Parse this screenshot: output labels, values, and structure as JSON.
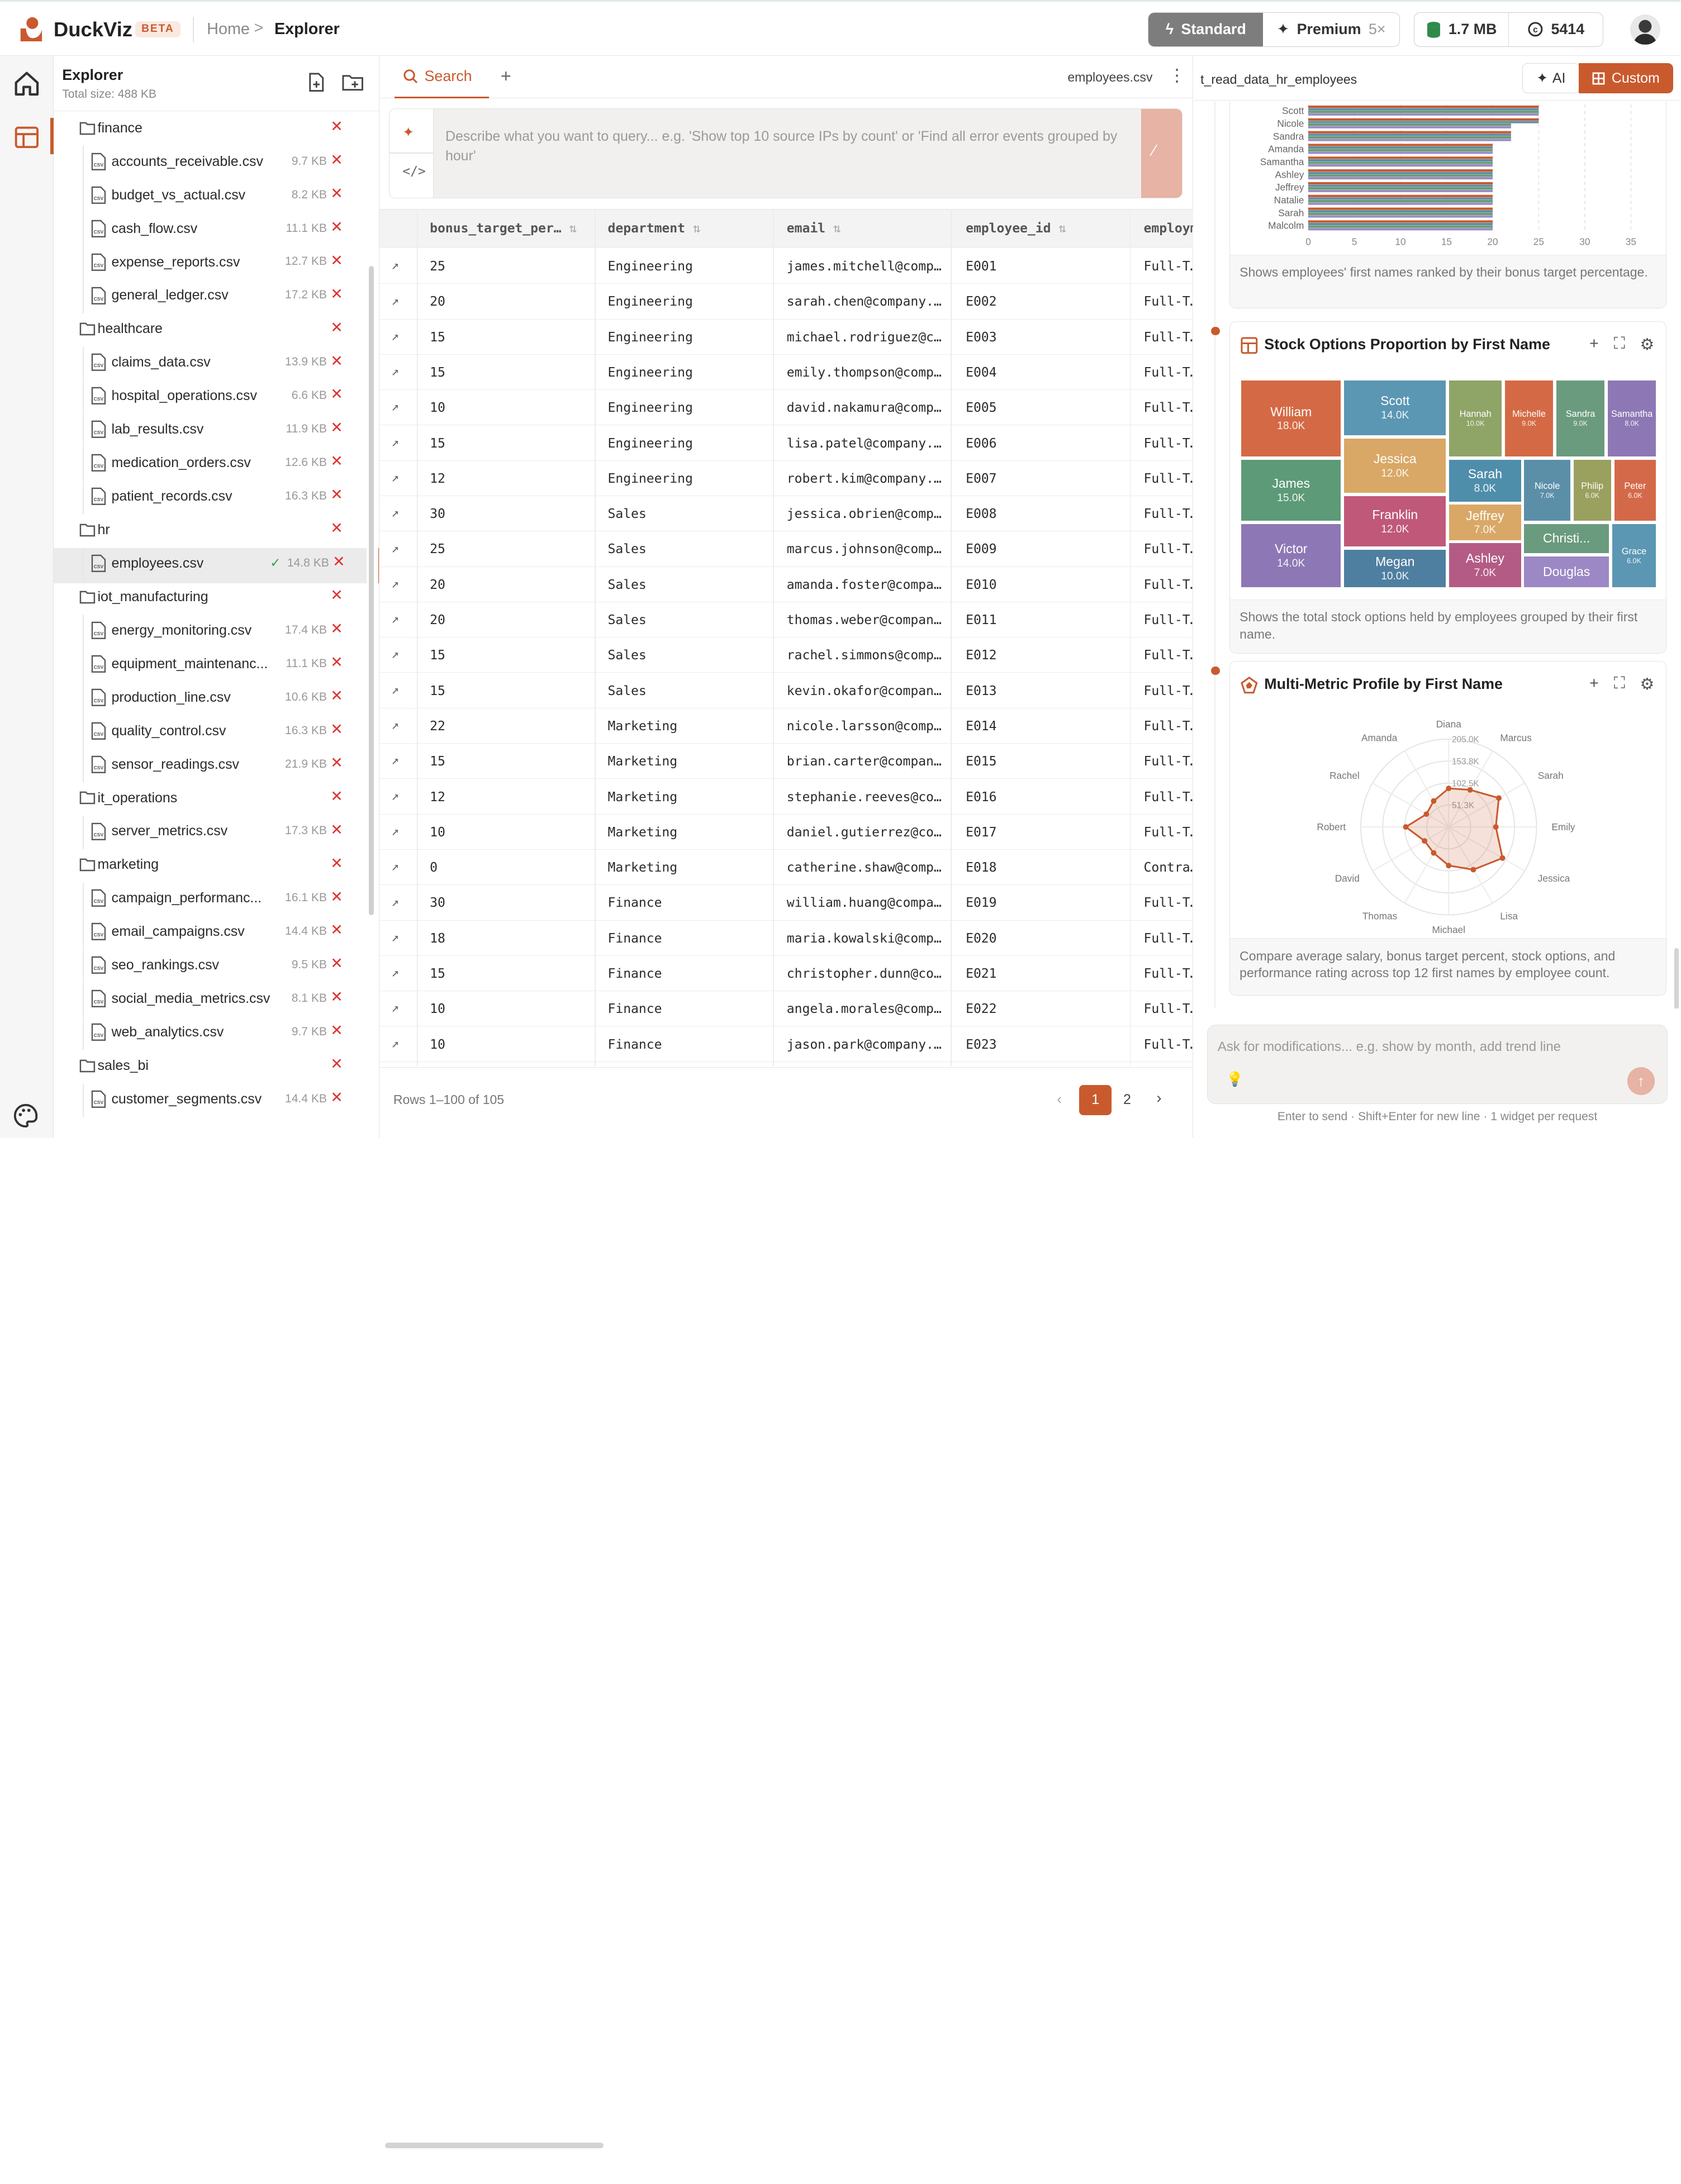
{
  "app": {
    "name": "DuckViz",
    "badge": "BETA"
  },
  "breadcrumb": {
    "home": "Home",
    "separator": ">",
    "current": "Explorer"
  },
  "tier": {
    "standard": "Standard",
    "premium": "Premium",
    "premium_mult": "5×"
  },
  "stats": {
    "storage": "1.7 MB",
    "credits": "5414"
  },
  "explorer": {
    "title": "Explorer",
    "total": "Total size: 488 KB",
    "tree": [
      {
        "type": "folder",
        "name": "finance"
      },
      {
        "type": "file",
        "name": "accounts_receivable.csv",
        "size": "9.7 KB"
      },
      {
        "type": "file",
        "name": "budget_vs_actual.csv",
        "size": "8.2 KB"
      },
      {
        "type": "file",
        "name": "cash_flow.csv",
        "size": "11.1 KB"
      },
      {
        "type": "file",
        "name": "expense_reports.csv",
        "size": "12.7 KB"
      },
      {
        "type": "file",
        "name": "general_ledger.csv",
        "size": "17.2 KB"
      },
      {
        "type": "folder",
        "name": "healthcare"
      },
      {
        "type": "file",
        "name": "claims_data.csv",
        "size": "13.9 KB"
      },
      {
        "type": "file",
        "name": "hospital_operations.csv",
        "size": "6.6 KB"
      },
      {
        "type": "file",
        "name": "lab_results.csv",
        "size": "11.9 KB"
      },
      {
        "type": "file",
        "name": "medication_orders.csv",
        "size": "12.6 KB"
      },
      {
        "type": "file",
        "name": "patient_records.csv",
        "size": "16.3 KB"
      },
      {
        "type": "folder",
        "name": "hr"
      },
      {
        "type": "file",
        "name": "employees.csv",
        "size": "14.8 KB",
        "selected": true
      },
      {
        "type": "folder",
        "name": "iot_manufacturing"
      },
      {
        "type": "file",
        "name": "energy_monitoring.csv",
        "size": "17.4 KB"
      },
      {
        "type": "file",
        "name": "equipment_maintenanc...",
        "size": "11.1 KB"
      },
      {
        "type": "file",
        "name": "production_line.csv",
        "size": "10.6 KB"
      },
      {
        "type": "file",
        "name": "quality_control.csv",
        "size": "16.3 KB"
      },
      {
        "type": "file",
        "name": "sensor_readings.csv",
        "size": "21.9 KB"
      },
      {
        "type": "folder",
        "name": "it_operations"
      },
      {
        "type": "file",
        "name": "server_metrics.csv",
        "size": "17.3 KB"
      },
      {
        "type": "folder",
        "name": "marketing"
      },
      {
        "type": "file",
        "name": "campaign_performanc...",
        "size": "16.1 KB"
      },
      {
        "type": "file",
        "name": "email_campaigns.csv",
        "size": "14.4 KB"
      },
      {
        "type": "file",
        "name": "seo_rankings.csv",
        "size": "9.5 KB"
      },
      {
        "type": "file",
        "name": "social_media_metrics.csv",
        "size": "8.1 KB"
      },
      {
        "type": "file",
        "name": "web_analytics.csv",
        "size": "9.7 KB"
      },
      {
        "type": "folder",
        "name": "sales_bi"
      },
      {
        "type": "file",
        "name": "customer_segments.csv",
        "size": "14.4 KB"
      }
    ]
  },
  "center": {
    "tab": "Search",
    "file": "employees.csv",
    "query_placeholder": "Describe what you want to query... e.g. 'Show top 10 source IPs by count' or 'Find all error events grouped by hour'",
    "columns": [
      "bonus_target_per…",
      "department",
      "email",
      "employee_id",
      "employm…"
    ],
    "rows": [
      [
        "25",
        "Engineering",
        "james.mitchell@comp…",
        "E001",
        "Full-T…"
      ],
      [
        "20",
        "Engineering",
        "sarah.chen@company.…",
        "E002",
        "Full-T…"
      ],
      [
        "15",
        "Engineering",
        "michael.rodriguez@c…",
        "E003",
        "Full-T…"
      ],
      [
        "15",
        "Engineering",
        "emily.thompson@comp…",
        "E004",
        "Full-T…"
      ],
      [
        "10",
        "Engineering",
        "david.nakamura@comp…",
        "E005",
        "Full-T…"
      ],
      [
        "15",
        "Engineering",
        "lisa.patel@company.…",
        "E006",
        "Full-T…"
      ],
      [
        "12",
        "Engineering",
        "robert.kim@company.…",
        "E007",
        "Full-T…"
      ],
      [
        "30",
        "Sales",
        "jessica.obrien@comp…",
        "E008",
        "Full-T…"
      ],
      [
        "25",
        "Sales",
        "marcus.johnson@comp…",
        "E009",
        "Full-T…"
      ],
      [
        "20",
        "Sales",
        "amanda.foster@compa…",
        "E010",
        "Full-T…"
      ],
      [
        "20",
        "Sales",
        "thomas.weber@compan…",
        "E011",
        "Full-T…"
      ],
      [
        "15",
        "Sales",
        "rachel.simmons@comp…",
        "E012",
        "Full-T…"
      ],
      [
        "15",
        "Sales",
        "kevin.okafor@compan…",
        "E013",
        "Full-T…"
      ],
      [
        "22",
        "Marketing",
        "nicole.larsson@comp…",
        "E014",
        "Full-T…"
      ],
      [
        "15",
        "Marketing",
        "brian.carter@compan…",
        "E015",
        "Full-T…"
      ],
      [
        "12",
        "Marketing",
        "stephanie.reeves@co…",
        "E016",
        "Full-T…"
      ],
      [
        "10",
        "Marketing",
        "daniel.gutierrez@co…",
        "E017",
        "Full-T…"
      ],
      [
        "0",
        "Marketing",
        "catherine.shaw@comp…",
        "E018",
        "Contra…"
      ],
      [
        "30",
        "Finance",
        "william.huang@compa…",
        "E019",
        "Full-T…"
      ],
      [
        "18",
        "Finance",
        "maria.kowalski@comp…",
        "E020",
        "Full-T…"
      ],
      [
        "15",
        "Finance",
        "christopher.dunn@co…",
        "E021",
        "Full-T…"
      ],
      [
        "10",
        "Finance",
        "angela.morales@comp…",
        "E022",
        "Full-T…"
      ],
      [
        "10",
        "Finance",
        "jason.park@company.…",
        "E023",
        "Full-T…"
      ]
    ],
    "pager": {
      "info": "Rows 1–100 of 105",
      "page1": "1",
      "page2": "2"
    }
  },
  "right": {
    "title": "t_read_data_hr_employees",
    "ai": "AI",
    "custom": "Custom",
    "cards": {
      "bar_desc": "Shows employees' first names ranked by their bonus target percentage.",
      "treemap_title": "Stock Options Proportion by First Name",
      "treemap_desc": "Shows the total stock options held by employees grouped by their first name.",
      "radar_title": "Multi-Metric Profile by First Name",
      "radar_desc": "Compare average salary, bonus target percent, stock options, and performance rating across top 12 first names by employee count."
    },
    "chat_placeholder": "Ask for modifications... e.g. show by month, add trend line",
    "chat_hint": "Enter to send · Shift+Enter for new line · 1 widget per request"
  },
  "chart_data": [
    {
      "type": "bar",
      "orientation": "horizontal",
      "categories": [
        "Scott",
        "Nicole",
        "Sandra",
        "Amanda",
        "Samantha",
        "Ashley",
        "Jeffrey",
        "Natalie",
        "Sarah",
        "Malcolm"
      ],
      "series": [
        {
          "values": [
            25,
            25,
            22,
            20,
            20,
            20,
            20,
            20,
            20,
            20
          ]
        },
        {
          "values": [
            25,
            25,
            22,
            20,
            20,
            20,
            20,
            20,
            20,
            20
          ]
        },
        {
          "values": [
            25,
            22,
            22,
            20,
            20,
            20,
            20,
            20,
            20,
            20
          ]
        },
        {
          "values": [
            25,
            22,
            22,
            20,
            20,
            20,
            20,
            20,
            20,
            20
          ]
        }
      ],
      "xticks": [
        "0",
        "5",
        "10",
        "15",
        "20",
        "25",
        "30",
        "35"
      ],
      "xlim": [
        0,
        35
      ],
      "colors": [
        "#c95a2e",
        "#5b8fa8",
        "#6a9b72",
        "#9b8cc4"
      ]
    },
    {
      "type": "treemap",
      "items": [
        {
          "name": "William",
          "label": "18.0K",
          "value": 18000,
          "color": "#d46a45"
        },
        {
          "name": "Scott",
          "label": "14.0K",
          "value": 14000,
          "color": "#5b96b3"
        },
        {
          "name": "Hannah",
          "label": "10.0K",
          "value": 10000,
          "color": "#8fa467"
        },
        {
          "name": "Michelle",
          "label": "9.0K",
          "value": 9000,
          "color": "#d46a45"
        },
        {
          "name": "Sandra",
          "label": "9.0K",
          "value": 9000,
          "color": "#6a9b7e"
        },
        {
          "name": "Samantha",
          "label": "8.0K",
          "value": 8000,
          "color": "#8d78b5"
        },
        {
          "name": "James",
          "label": "15.0K",
          "value": 15000,
          "color": "#5c9a78"
        },
        {
          "name": "Jessica",
          "label": "12.0K",
          "value": 12000,
          "color": "#d9a866"
        },
        {
          "name": "Sarah",
          "label": "8.0K",
          "value": 8000,
          "color": "#4f8eab"
        },
        {
          "name": "Nicole",
          "label": "7.0K",
          "value": 7000,
          "color": "#5b8fa8"
        },
        {
          "name": "Philip",
          "label": "6.0K",
          "value": 6000,
          "color": "#9aa05e"
        },
        {
          "name": "Peter",
          "label": "6.0K",
          "value": 6000,
          "color": "#d4694a"
        },
        {
          "name": "Franklin",
          "label": "12.0K",
          "value": 12000,
          "color": "#c0587a"
        },
        {
          "name": "Jeffrey",
          "label": "7.0K",
          "value": 7000,
          "color": "#d9a866"
        },
        {
          "name": "Victor",
          "label": "14.0K",
          "value": 14000,
          "color": "#8d78b5"
        },
        {
          "name": "Megan",
          "label": "10.0K",
          "value": 10000,
          "color": "#4f7fa0"
        },
        {
          "name": "Ashley",
          "label": "7.0K",
          "value": 7000,
          "color": "#b45b85"
        },
        {
          "name": "Christi...",
          "label": "",
          "value": 6500,
          "color": "#6a9b7e"
        },
        {
          "name": "Grace",
          "label": "6.0K",
          "value": 6000,
          "color": "#5b96b3"
        },
        {
          "name": "Douglas",
          "label": "",
          "value": 6000,
          "color": "#9b88c4"
        }
      ]
    },
    {
      "type": "radar",
      "axes": [
        "Marcus",
        "Sarah",
        "Emily",
        "Jessica",
        "Lisa",
        "Michael",
        "Thomas",
        "David",
        "Robert",
        "Rachel",
        "Amanda",
        "Diana"
      ],
      "rings": [
        "51.3K",
        "102.5K",
        "153.8K",
        "205.0K"
      ],
      "max": 205000,
      "values": [
        100000,
        135000,
        110000,
        145000,
        115000,
        90000,
        70000,
        65000,
        100000,
        60000,
        70000,
        90000
      ]
    }
  ]
}
